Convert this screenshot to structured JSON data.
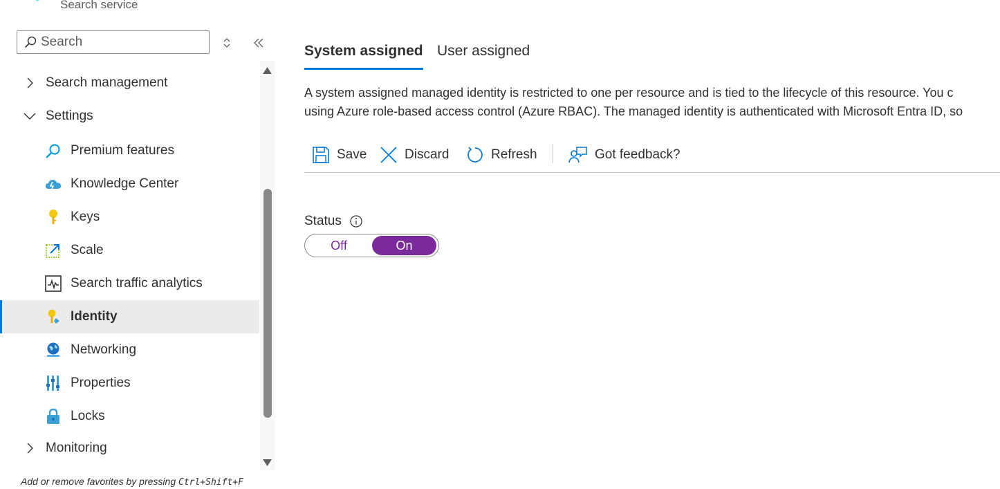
{
  "header": {
    "subtitle": "Search service"
  },
  "sidebar": {
    "search_placeholder": "Search",
    "items": [
      {
        "label": "Search management",
        "type": "group",
        "expanded": false,
        "icon": "chevron-right-icon"
      },
      {
        "label": "Settings",
        "type": "group",
        "expanded": true,
        "icon": "chevron-down-icon"
      },
      {
        "label": "Premium features",
        "type": "child",
        "icon": "magnifier-icon"
      },
      {
        "label": "Knowledge Center",
        "type": "child",
        "icon": "cloud-icon"
      },
      {
        "label": "Keys",
        "type": "child",
        "icon": "key-icon"
      },
      {
        "label": "Scale",
        "type": "child",
        "icon": "scale-icon"
      },
      {
        "label": "Search traffic analytics",
        "type": "child",
        "icon": "analytics-icon"
      },
      {
        "label": "Identity",
        "type": "child",
        "icon": "identity-key-icon",
        "selected": true
      },
      {
        "label": "Networking",
        "type": "child",
        "icon": "globe-icon"
      },
      {
        "label": "Properties",
        "type": "child",
        "icon": "properties-icon"
      },
      {
        "label": "Locks",
        "type": "child",
        "icon": "lock-icon"
      },
      {
        "label": "Monitoring",
        "type": "group",
        "expanded": false,
        "icon": "chevron-right-icon"
      }
    ],
    "favorites_hint": "Add or remove favorites by pressing ",
    "favorites_shortcut": "Ctrl+Shift+F"
  },
  "main": {
    "tabs": [
      {
        "label": "System assigned",
        "active": true
      },
      {
        "label": "User assigned",
        "active": false
      }
    ],
    "description_line1": "A system assigned managed identity is restricted to one per resource and is tied to the lifecycle of this resource. You c",
    "description_line2": "using Azure role-based access control (Azure RBAC). The managed identity is authenticated with Microsoft Entra ID, so",
    "toolbar": {
      "save_label": "Save",
      "discard_label": "Discard",
      "refresh_label": "Refresh",
      "feedback_label": "Got feedback?"
    },
    "status": {
      "label": "Status",
      "off_label": "Off",
      "on_label": "On",
      "value": "On"
    }
  },
  "colors": {
    "accent": "#0078d4",
    "toggle_on": "#7b2a9c",
    "selected_bg": "#edebe9"
  }
}
